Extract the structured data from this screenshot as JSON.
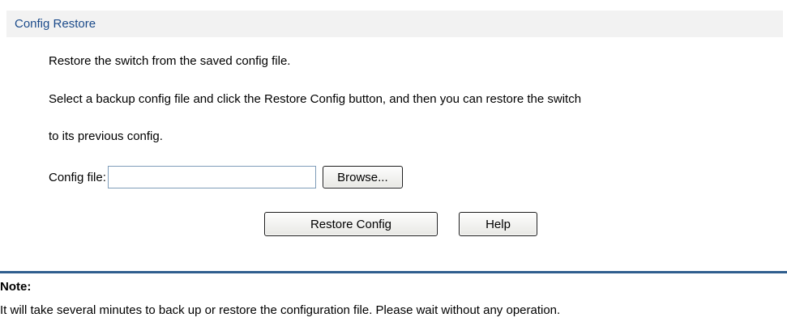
{
  "section": {
    "title": "Config Restore"
  },
  "description": {
    "line1": "Restore the switch from the saved config file.",
    "line2": "Select a backup config file and click the Restore Config button, and then you can restore the switch",
    "line3": "to its previous config."
  },
  "file": {
    "label": "Config file:",
    "value": "",
    "browse_label": "Browse..."
  },
  "actions": {
    "restore_label": "Restore Config",
    "help_label": "Help"
  },
  "note": {
    "title": "Note:",
    "text": "It will take several minutes to back up or restore the configuration file. Please wait without any operation."
  },
  "colors": {
    "header_bg": "#f2f2f2",
    "header_text": "#1a4a8a",
    "divider": "#2f5e8e"
  }
}
